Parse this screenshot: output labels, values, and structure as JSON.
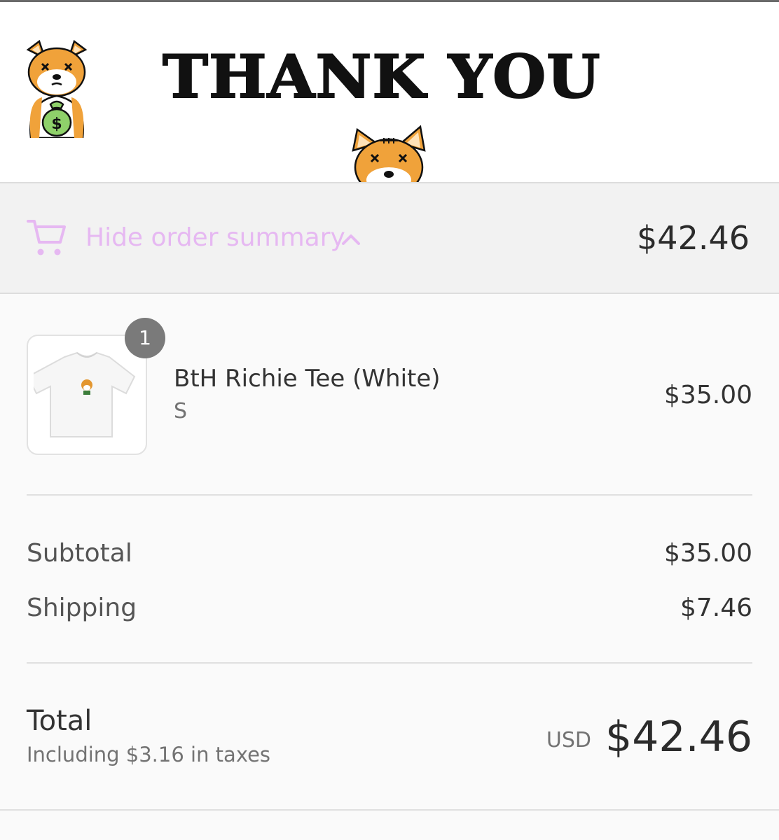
{
  "header": {
    "title": "THANK YOU",
    "logo_icon": "shiba-money-bag-logo-icon",
    "mascot_icon": "shiba-peek-icon"
  },
  "summary_toggle": {
    "label": "Hide order summary",
    "icon": "cart-icon",
    "chevron": "chevron-up-icon",
    "total": "$42.46",
    "accent_color": "#e6b8f2"
  },
  "line_items": [
    {
      "name": "BtH Richie Tee (White)",
      "variant": "S",
      "price": "$35.00",
      "quantity": "1",
      "thumbnail_icon": "white-tshirt-thumbnail"
    }
  ],
  "totals": {
    "subtotal_label": "Subtotal",
    "subtotal_value": "$35.00",
    "shipping_label": "Shipping",
    "shipping_value": "$7.46",
    "total_label": "Total",
    "tax_note": "Including $3.16 in taxes",
    "currency": "USD",
    "total_value": "$42.46"
  }
}
